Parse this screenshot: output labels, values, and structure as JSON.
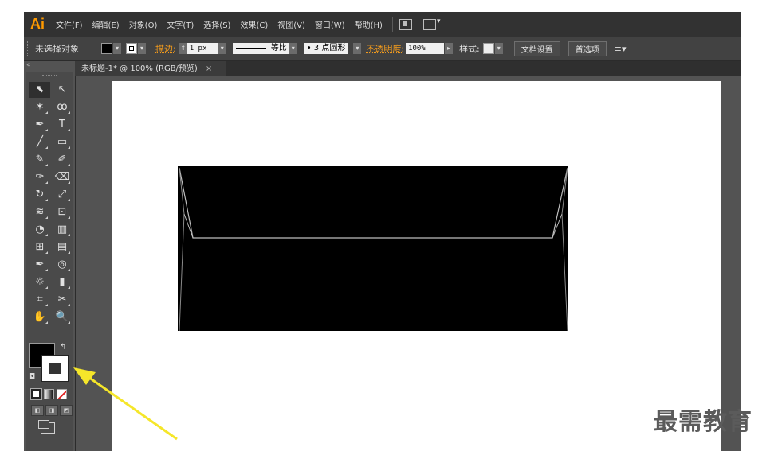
{
  "app": {
    "logo": "Ai",
    "menu": [
      "文件(F)",
      "编辑(E)",
      "对象(O)",
      "文字(T)",
      "选择(S)",
      "效果(C)",
      "视图(V)",
      "窗口(W)",
      "帮助(H)"
    ],
    "menu_icons": [
      "bridge-icon",
      "arrange-documents-icon"
    ]
  },
  "control_bar": {
    "selection_label": "未选择对象",
    "stroke_label": "描边:",
    "stroke_value": "1 px",
    "profile_label": "等比",
    "brush_label": "• 3 点圆形",
    "opacity_label": "不透明度:",
    "opacity_value": "100%",
    "style_label": "样式:",
    "doc_setup_button": "文档设置",
    "prefs_button": "首选项"
  },
  "document": {
    "tab_title": "未标题-1* @ 100% (RGB/预览)",
    "close": "×"
  },
  "toolbox": {
    "tools": [
      "selection-tool-icon",
      "direct-selection-tool-icon",
      "magic-wand-tool-icon",
      "lasso-tool-icon",
      "pen-tool-icon",
      "type-tool-icon",
      "line-segment-tool-icon",
      "rectangle-tool-icon",
      "paintbrush-tool-icon",
      "pencil-tool-icon",
      "blob-brush-tool-icon",
      "eraser-tool-icon",
      "rotate-tool-icon",
      "scale-tool-icon",
      "width-tool-icon",
      "free-transform-tool-icon",
      "shape-builder-tool-icon",
      "perspective-grid-tool-icon",
      "mesh-tool-icon",
      "gradient-tool-icon",
      "eyedropper-tool-icon",
      "blend-tool-icon",
      "symbol-sprayer-tool-icon",
      "column-graph-tool-icon",
      "artboard-tool-icon",
      "slice-tool-icon",
      "hand-tool-icon",
      "zoom-tool-icon"
    ],
    "glyphs": [
      "⬉",
      "↖",
      "✶",
      "ꝏ",
      "✒",
      "T",
      "╱",
      "▭",
      "✎",
      "✐",
      "✑",
      "⌫",
      "↻",
      "⤢",
      "≋",
      "⊡",
      "◔",
      "▥",
      "⊞",
      "▤",
      "✒",
      "◎",
      "☼",
      "▮",
      "⌗",
      "✂",
      "✋",
      "🔍"
    ],
    "fill_color": "#000000",
    "stroke_color": "#ffffff"
  },
  "artwork": {
    "envelope_fill": "#000000",
    "envelope_line": "#bdbdbd"
  },
  "watermark": "最需教育",
  "colors": {
    "accent_orange": "#ff9a00",
    "annotation_arrow": "#f5e62a"
  }
}
